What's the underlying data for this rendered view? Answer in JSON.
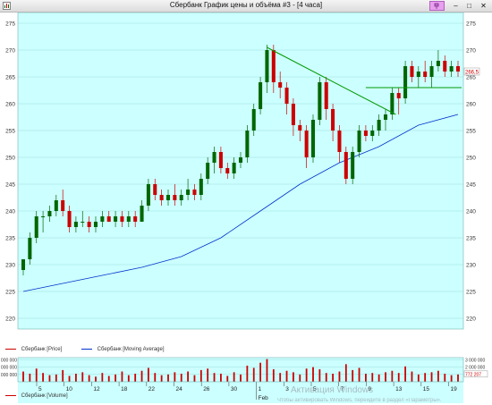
{
  "window": {
    "title": "Сбербанк График цены и объёма #3 - [4 часа]",
    "buttons": {
      "minimize": "–",
      "maximize": "□",
      "close": "✕",
      "pin": "📌"
    }
  },
  "legend": {
    "price_label": "Сбербанк [Price]",
    "ma_label": "Сбербанк [Moving Average]",
    "price_color": "#cc0000",
    "ma_color": "#0033cc",
    "volume_label": "Сбербанк [Volume]"
  },
  "price_axis": {
    "ticks": [
      "275",
      "270",
      "265",
      "260",
      "255",
      "250",
      "245",
      "240",
      "235",
      "230",
      "225",
      "220"
    ],
    "current_price": "266,5"
  },
  "volume_axis": {
    "ticks": [
      "3 000 000",
      "2 000 000",
      "1 000 000"
    ],
    "current_volume": "772 207"
  },
  "date_axis": {
    "day_labels": [
      "5",
      "10",
      "12",
      "18",
      "22",
      "24",
      "26",
      "30",
      "1",
      "3",
      "5",
      "7",
      "9",
      "13",
      "15",
      "19"
    ],
    "month_label": "Feb"
  },
  "watermark": {
    "line1": "Активация Windows",
    "line2": "Чтобы активировать Windows, перейдите в раздел «Параметры»."
  },
  "colors": {
    "background": "#ccffff",
    "up_candle": "#006600",
    "down_candle": "#cc0000",
    "trendline": "#009900",
    "moving_average": "#0033cc",
    "grid": "#9fdede"
  },
  "chart_data": {
    "type": "candlestick",
    "title": "",
    "ylim": [
      218,
      277
    ],
    "candles": [
      {
        "o": 229,
        "h": 231,
        "l": 228,
        "c": 231
      },
      {
        "o": 231,
        "h": 236,
        "l": 230,
        "c": 235
      },
      {
        "o": 235,
        "h": 240,
        "l": 234,
        "c": 239
      },
      {
        "o": 239,
        "h": 240,
        "l": 236,
        "c": 239
      },
      {
        "o": 239,
        "h": 241,
        "l": 238,
        "c": 240
      },
      {
        "o": 240,
        "h": 243,
        "l": 239,
        "c": 242
      },
      {
        "o": 242,
        "h": 244,
        "l": 239,
        "c": 240
      },
      {
        "o": 240,
        "h": 241,
        "l": 236,
        "c": 237
      },
      {
        "o": 237,
        "h": 239,
        "l": 236,
        "c": 238
      },
      {
        "o": 238,
        "h": 240,
        "l": 237,
        "c": 238
      },
      {
        "o": 238,
        "h": 239,
        "l": 236,
        "c": 237
      },
      {
        "o": 237,
        "h": 239,
        "l": 236,
        "c": 238
      },
      {
        "o": 238,
        "h": 240,
        "l": 237,
        "c": 239
      },
      {
        "o": 239,
        "h": 240,
        "l": 238,
        "c": 238
      },
      {
        "o": 238,
        "h": 240,
        "l": 237,
        "c": 239
      },
      {
        "o": 239,
        "h": 240,
        "l": 237,
        "c": 238
      },
      {
        "o": 238,
        "h": 240,
        "l": 237,
        "c": 239
      },
      {
        "o": 239,
        "h": 240,
        "l": 237,
        "c": 238
      },
      {
        "o": 238,
        "h": 242,
        "l": 238,
        "c": 241
      },
      {
        "o": 241,
        "h": 246,
        "l": 240,
        "c": 245
      },
      {
        "o": 245,
        "h": 246,
        "l": 242,
        "c": 243
      },
      {
        "o": 243,
        "h": 244,
        "l": 241,
        "c": 242
      },
      {
        "o": 242,
        "h": 244,
        "l": 241,
        "c": 243
      },
      {
        "o": 243,
        "h": 245,
        "l": 241,
        "c": 242
      },
      {
        "o": 242,
        "h": 244,
        "l": 241,
        "c": 243
      },
      {
        "o": 243,
        "h": 246,
        "l": 242,
        "c": 244
      },
      {
        "o": 244,
        "h": 245,
        "l": 242,
        "c": 243
      },
      {
        "o": 243,
        "h": 247,
        "l": 242,
        "c": 246
      },
      {
        "o": 246,
        "h": 250,
        "l": 245,
        "c": 249
      },
      {
        "o": 249,
        "h": 252,
        "l": 247,
        "c": 251
      },
      {
        "o": 251,
        "h": 252,
        "l": 247,
        "c": 248
      },
      {
        "o": 248,
        "h": 249,
        "l": 246,
        "c": 247
      },
      {
        "o": 247,
        "h": 250,
        "l": 246,
        "c": 249
      },
      {
        "o": 249,
        "h": 251,
        "l": 248,
        "c": 250
      },
      {
        "o": 250,
        "h": 256,
        "l": 249,
        "c": 255
      },
      {
        "o": 255,
        "h": 260,
        "l": 254,
        "c": 259
      },
      {
        "o": 259,
        "h": 265,
        "l": 258,
        "c": 264
      },
      {
        "o": 264,
        "h": 271,
        "l": 262,
        "c": 270
      },
      {
        "o": 270,
        "h": 271,
        "l": 262,
        "c": 264
      },
      {
        "o": 264,
        "h": 266,
        "l": 261,
        "c": 263
      },
      {
        "o": 263,
        "h": 264,
        "l": 258,
        "c": 260
      },
      {
        "o": 260,
        "h": 261,
        "l": 254,
        "c": 256
      },
      {
        "o": 256,
        "h": 257,
        "l": 253,
        "c": 255
      },
      {
        "o": 255,
        "h": 256,
        "l": 248,
        "c": 250
      },
      {
        "o": 250,
        "h": 258,
        "l": 249,
        "c": 257
      },
      {
        "o": 257,
        "h": 265,
        "l": 256,
        "c": 264
      },
      {
        "o": 264,
        "h": 265,
        "l": 257,
        "c": 259
      },
      {
        "o": 259,
        "h": 260,
        "l": 253,
        "c": 255
      },
      {
        "o": 255,
        "h": 256,
        "l": 249,
        "c": 251
      },
      {
        "o": 251,
        "h": 252,
        "l": 245,
        "c": 246
      },
      {
        "o": 246,
        "h": 252,
        "l": 245,
        "c": 251
      },
      {
        "o": 251,
        "h": 256,
        "l": 250,
        "c": 255
      },
      {
        "o": 255,
        "h": 256,
        "l": 253,
        "c": 254
      },
      {
        "o": 254,
        "h": 256,
        "l": 253,
        "c": 255
      },
      {
        "o": 255,
        "h": 258,
        "l": 254,
        "c": 257
      },
      {
        "o": 257,
        "h": 259,
        "l": 255,
        "c": 258
      },
      {
        "o": 258,
        "h": 263,
        "l": 257,
        "c": 262
      },
      {
        "o": 262,
        "h": 263,
        "l": 258,
        "c": 261
      },
      {
        "o": 261,
        "h": 268,
        "l": 260,
        "c": 267
      },
      {
        "o": 267,
        "h": 268,
        "l": 264,
        "c": 265
      },
      {
        "o": 265,
        "h": 267,
        "l": 263,
        "c": 266
      },
      {
        "o": 266,
        "h": 268,
        "l": 264,
        "c": 265
      },
      {
        "o": 265,
        "h": 268,
        "l": 263,
        "c": 267
      },
      {
        "o": 267,
        "h": 270,
        "l": 266,
        "c": 268
      },
      {
        "o": 268,
        "h": 269,
        "l": 265,
        "c": 266
      },
      {
        "o": 266,
        "h": 268,
        "l": 265,
        "c": 267
      },
      {
        "o": 267,
        "h": 268,
        "l": 265,
        "c": 266
      }
    ],
    "moving_average": [
      {
        "i": 0,
        "v": 225
      },
      {
        "i": 6,
        "v": 226.5
      },
      {
        "i": 12,
        "v": 228
      },
      {
        "i": 18,
        "v": 229.5
      },
      {
        "i": 24,
        "v": 231.5
      },
      {
        "i": 30,
        "v": 235
      },
      {
        "i": 36,
        "v": 240
      },
      {
        "i": 42,
        "v": 245
      },
      {
        "i": 48,
        "v": 249
      },
      {
        "i": 54,
        "v": 252
      },
      {
        "i": 60,
        "v": 256
      },
      {
        "i": 66,
        "v": 258
      }
    ],
    "volume": [
      1.4,
      1.1,
      1.8,
      1.2,
      0.9,
      1.0,
      1.6,
      0.8,
      1.1,
      1.3,
      0.9,
      0.7,
      1.2,
      0.8,
      1.0,
      1.4,
      0.9,
      1.1,
      1.5,
      1.9,
      1.2,
      0.9,
      1.0,
      1.3,
      1.1,
      1.4,
      0.9,
      1.6,
      1.8,
      1.2,
      1.1,
      0.8,
      1.3,
      1.0,
      2.2,
      1.9,
      2.6,
      3.1,
      1.7,
      1.2,
      1.5,
      1.3,
      1.0,
      1.8,
      2.0,
      1.7,
      1.2,
      1.1,
      1.4,
      2.4,
      1.6,
      1.9,
      1.1,
      1.2,
      1.0,
      1.3,
      1.5,
      1.2,
      2.1,
      1.4,
      1.0,
      1.2,
      1.3,
      1.5,
      1.1,
      0.9,
      1.0
    ],
    "trendlines": [
      {
        "from": {
          "i": 37,
          "v": 270.5
        },
        "to": {
          "i": 56,
          "v": 258
        }
      },
      {
        "from": {
          "i": 52,
          "v": 263
        },
        "to": {
          "i": 66,
          "v": 263
        }
      }
    ]
  }
}
